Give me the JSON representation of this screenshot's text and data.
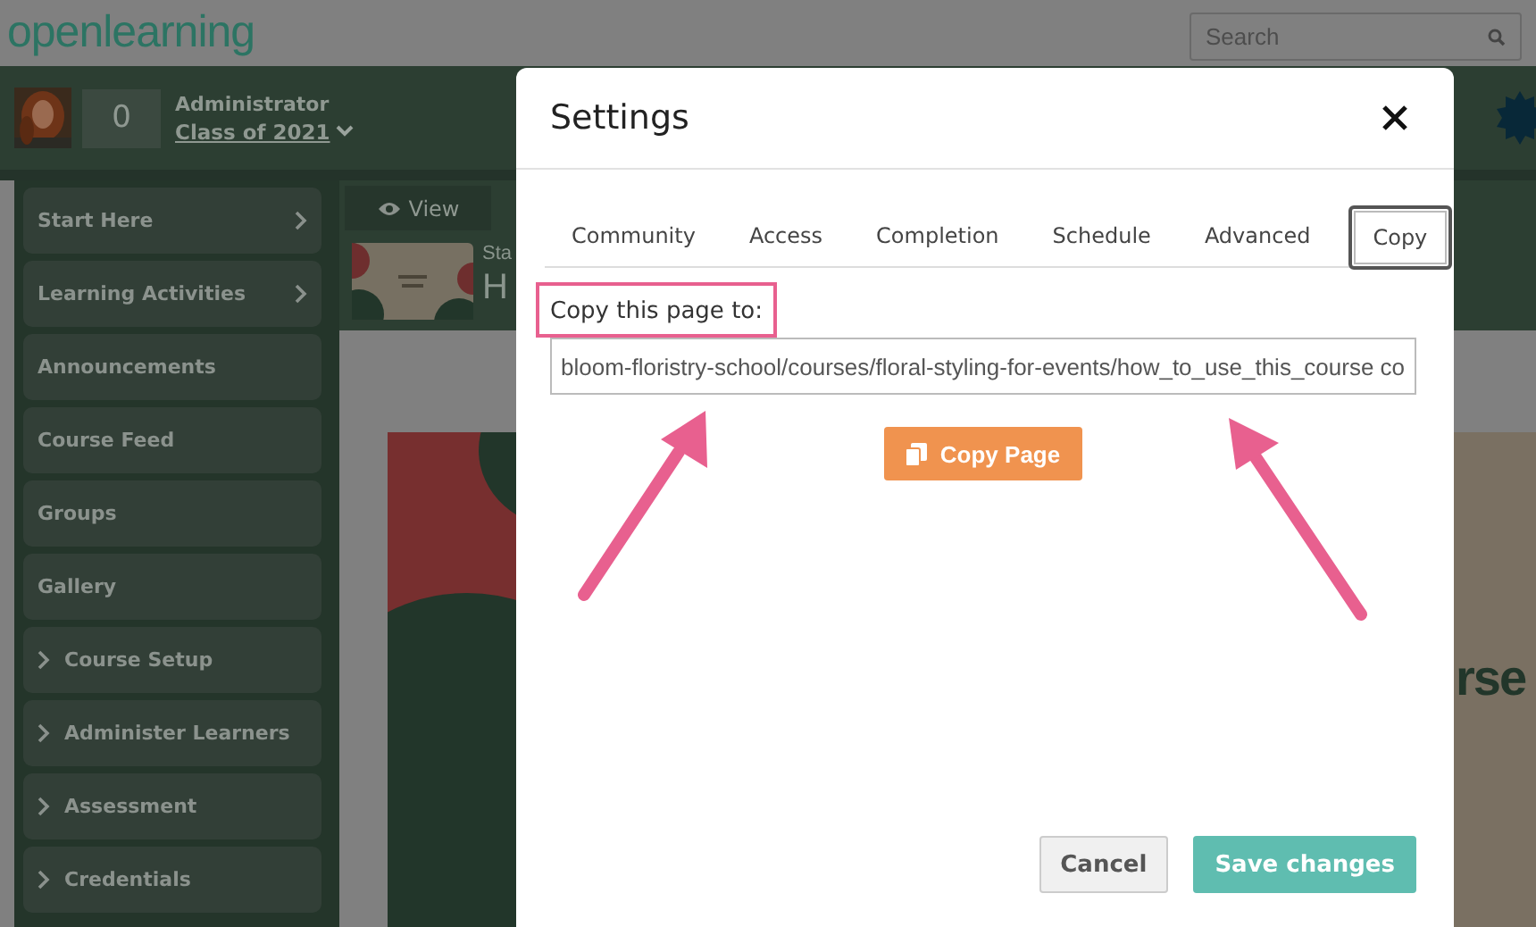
{
  "app": {
    "logo": "openlearning",
    "search": {
      "placeholder": "Search"
    }
  },
  "user": {
    "count": "0",
    "role": "Administrator",
    "class_name": "Class of 2021"
  },
  "sidebar": {
    "items": [
      {
        "label": "Start Here",
        "kind": "link"
      },
      {
        "label": "Learning Activities",
        "kind": "link"
      },
      {
        "label": "Announcements",
        "kind": "plain"
      },
      {
        "label": "Course Feed",
        "kind": "plain"
      },
      {
        "label": "Groups",
        "kind": "plain"
      },
      {
        "label": "Gallery",
        "kind": "plain"
      },
      {
        "label": "Course Setup",
        "kind": "group"
      },
      {
        "label": "Administer Learners",
        "kind": "group"
      },
      {
        "label": "Assessment",
        "kind": "group"
      },
      {
        "label": "Credentials",
        "kind": "group"
      }
    ]
  },
  "content": {
    "view_tab": "View",
    "breadcrumb": "Sta",
    "title": "H",
    "banner_text": "rse"
  },
  "dialog": {
    "title": "Settings",
    "tabs": [
      {
        "label": "Community",
        "selected": false
      },
      {
        "label": "Access",
        "selected": false
      },
      {
        "label": "Completion",
        "selected": false
      },
      {
        "label": "Schedule",
        "selected": false
      },
      {
        "label": "Advanced",
        "selected": false
      },
      {
        "label": "Copy",
        "selected": true
      }
    ],
    "field_label": {
      "text": "Copy this page to:",
      "highlighted": true
    },
    "field_value": "bloom-floristry-school/courses/floral-styling-for-events/how_to_use_this_course co",
    "copy_button": "Copy Page",
    "buttons": [
      {
        "label": "Cancel",
        "kind": "secondary"
      },
      {
        "label": "Save changes",
        "kind": "primary"
      }
    ]
  }
}
